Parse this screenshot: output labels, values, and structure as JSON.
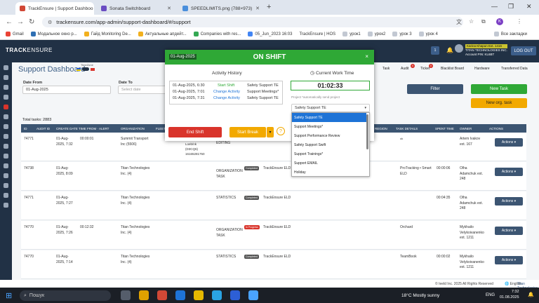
{
  "browser": {
    "tabs": [
      {
        "title": "TrackEnsure | Support Dashboo",
        "active": true,
        "color": "#d14836"
      },
      {
        "title": "Sonata Switchboard",
        "active": false,
        "color": "#6a4cc2"
      },
      {
        "title": "SPEEDLIMITS.png (788×973)",
        "active": false,
        "color": "#4a8fdc"
      }
    ],
    "url": "trackensure.com/app-admin/support-dashboard/#/support",
    "bookmarks": [
      "Gmail",
      "Модальное окно р...",
      "Гайд Monitoring De...",
      "Актуальные апдейт...",
      "Companies with res...",
      "05_Jun_2023 16:03",
      "TrackEnsure | HOS",
      "урок1",
      "урок2",
      "урок 3",
      "урок 4"
    ],
    "bookmarks_all": "Все закладки"
  },
  "app": {
    "logo_bold": "TRACK",
    "logo_rest": "ENSURE",
    "page_title": "Support Dashboard",
    "timezone_label": "TimeZone",
    "user_name": "Karina Khapun Ext. 1416",
    "company": "TITAN TECHNOLOGIES INC.",
    "account_pin": "Account PIN: KL6BT",
    "notif_count": "1",
    "logout": "LOG OUT"
  },
  "filters": {
    "date_from_label": "Date From",
    "date_from_value": "01-Aug-2025",
    "date_to_label": "Date To",
    "date_to_placeholder": "Select date",
    "filter_button": "Filter",
    "new_task_button": "New Task",
    "new_org_task_button": "New org. task"
  },
  "right_tabs": [
    {
      "label": "Task",
      "badge": ""
    },
    {
      "label": "Audit",
      "badge": "0"
    },
    {
      "label": "Ticket",
      "badge": "0"
    },
    {
      "label": "Blacklist Board",
      "badge": ""
    },
    {
      "label": "Hardware",
      "badge": ""
    },
    {
      "label": "Transferred Data",
      "badge": ""
    }
  ],
  "total_tasks": "Total tasks: 2883",
  "table": {
    "headers": [
      "ID",
      "AUDIT ID",
      "CREATE DATE",
      "TIME FROM · ALERT",
      "ORGANIZATION",
      "FLEET",
      "REGION",
      "TASK DETAILS",
      "SPENT TIME",
      "OWNER",
      "ACTIONS"
    ],
    "rows": [
      {
        "id": "74771⁠",
        "date": "01-Aug-\n2025, 7:32",
        "time": "00:00:01",
        "org": "Summit Transport\nInc (5506)",
        "extra": "Loeb/nk\n(D3CQ6)\n16165281750",
        "type": "EDITING",
        "status": "",
        "status_color": "",
        "product": "",
        "details": "ok",
        "spent": "",
        "owner": "Artem Ivakov\next. 167",
        "actions": "Actions ▾"
      },
      {
        "id": "74738",
        "date": "01-Aug-\n2025, 8:09",
        "time": "",
        "org": "Titan Technologies\nInc. (4)",
        "extra": "",
        "type": "ORGANIZATION\nTASK",
        "status": "Completed",
        "status_color": "#555555",
        "product": "TrackEnsure ELD",
        "details": "ProTracking • Smart\nELD",
        "spent": "00:00:06",
        "owner": "Olha\nAdamchuk ext.\n248",
        "actions": "Actions ▾"
      },
      {
        "id": "74771",
        "date": "01-Aug-\n2025, 7:27",
        "time": "",
        "org": "Titan Technologies\nInc. (4)",
        "extra": "",
        "type": "STATISTICS",
        "status": "Completed",
        "status_color": "#555555",
        "product": "TrackEnsure ELD",
        "details": "",
        "spent": "00:04:35",
        "owner": "Olha\nAdamchuk ext.\n248",
        "actions": "Actions ▾"
      },
      {
        "id": "74770",
        "date": "01-Aug-\n2025, 7:26",
        "time": "00:12:32",
        "org": "Titan Technologies\nInc. (4)",
        "extra": "",
        "type": "ORGANIZATION\nTASK",
        "status": "In Progress",
        "status_color": "#d9342b",
        "product": "TrackEnsure ELD",
        "details": "Orchard",
        "spent": "",
        "owner": "Mykhailo\nVelykoivanenko\next. 1211",
        "actions": "Actions ▾"
      },
      {
        "id": "74770",
        "date": "01-Aug-\n2025, 7:14",
        "time": "",
        "org": "Titan Technologies\nInc. (4)",
        "extra": "",
        "type": "STATISTICS",
        "status": "Completed",
        "status_color": "#555555",
        "product": "TrackEnsure ELD",
        "details": "TeamBook",
        "spent": "00:00:02",
        "owner": "Mykhailo\nVelykoivanenko\next. 1211",
        "actions": "Actions ▾"
      }
    ]
  },
  "modal": {
    "date": "01-Aug-2025",
    "title": "ON SHIFT",
    "close": "×",
    "activity_history_label": "Activity History",
    "current_work_time_label": "Current Work Time",
    "history": [
      {
        "time": "01-Aug-2025, 6:30",
        "action": "Start Shift",
        "action_color": "#2fa836",
        "project": "Safety Support TE"
      },
      {
        "time": "01-Aug-2025, 7:01",
        "action": "Change Activity",
        "action_color": "#1e73d6",
        "project": "Support Meetings*"
      },
      {
        "time": "01-Aug-2025, 7:31",
        "action": "Change Activity",
        "action_color": "#1e73d6",
        "project": "Safety Support TE"
      }
    ],
    "timer": "01:02:33",
    "project_hint": "Project *automatically send project",
    "project_selected": "Safety Support TE",
    "project_options": [
      "Safety Support TE",
      "Support Meetings*",
      "Support Performance Review",
      "Safety Support Swift",
      "Support Trainings*",
      "Support EMAIL",
      "Holiday"
    ],
    "end_shift": "End Shift",
    "start_break": "Start Break"
  },
  "footer": {
    "copyright": "© Ieeld Inc. 2025 All Rights Reserved",
    "language": "English",
    "brand": "Titan Technologies"
  },
  "taskbar": {
    "search": "Пошук",
    "weather": "18°C  Mostly sunny",
    "lang": "ENG",
    "time": "7:32",
    "date": "01.08.2025"
  },
  "colors": {
    "brand_dark": "#213145",
    "accent_green": "#2fa836",
    "table_head": "#3c5572",
    "danger": "#d9342b",
    "warning": "#f2a900"
  }
}
